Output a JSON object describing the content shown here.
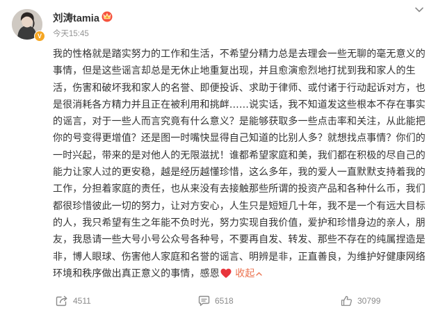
{
  "user": {
    "name": "刘涛tamia",
    "timestamp": "今天15:45",
    "verified_badge": "V"
  },
  "post": {
    "lines": [
      "我的性格就是踏实努力的工作和生活，不希望分精力总是去理会一些无聊的毫无意义的",
      "事情，但是这些谣言却总是无休止地重复出现，并且愈演愈烈地打扰到我和家人的生",
      "活，伤害和破坏我和家人的名誉、即便投诉、求助于律师、或付诸于行动起诉对方，也",
      "是很消耗各方精力并且正在被利用和挑衅……说实话，我不知道发这些根本不存在事实",
      "的谣言，对于一些人而言究竟有什么意义？是能够获取多一些点击率和关注，从此能把",
      "你的号变得更增值？还是图一时嘴快显得自己知道的比别人多？就想找点事情？你们的",
      "一时兴起，带来的是对他人的无限滋扰！谁都希望家庭和美，我们都在积极的尽自己的",
      "能力让家人过的更安稳，越是经历越懂珍惜，这么多年，我的爱人一直默默支持着我的",
      "工作，分担着家庭的责任，也从来没有去接触那些所谓的投资产品和各种什么币，我们",
      "都很珍惜彼此一切的努力，让对方安心，人生只是短短几十年，我不是一个有远大目标",
      "的人，我只希望有生之年能不负时光，努力实现自我价值，爱护和珍惜身边的亲人，朋",
      "友，我恳请一些大号小号公众号各种号，不要再自发、转发、那些不存在的纯属捏造是",
      "非，博人眼球、伤害他人家庭和名誉的谣言、明辨是非，正直善良，为维护好健康网络"
    ],
    "last_line": "环境和秩序做出真正意义的事情，感恩",
    "collapse_label": "收起"
  },
  "actions": {
    "share_count": "4511",
    "comment_count": "6518",
    "like_count": "30799"
  },
  "icons": {
    "more": "chevron-down-icon",
    "share": "share-icon",
    "comment": "comment-icon",
    "like": "thumbs-up-icon",
    "heart": "heart-icon",
    "crown": "crown-badge-icon"
  },
  "colors": {
    "text": "#333333",
    "meta": "#939393",
    "link": "#eb7350",
    "heart": "#e8343b",
    "badge": "#f5a623"
  }
}
